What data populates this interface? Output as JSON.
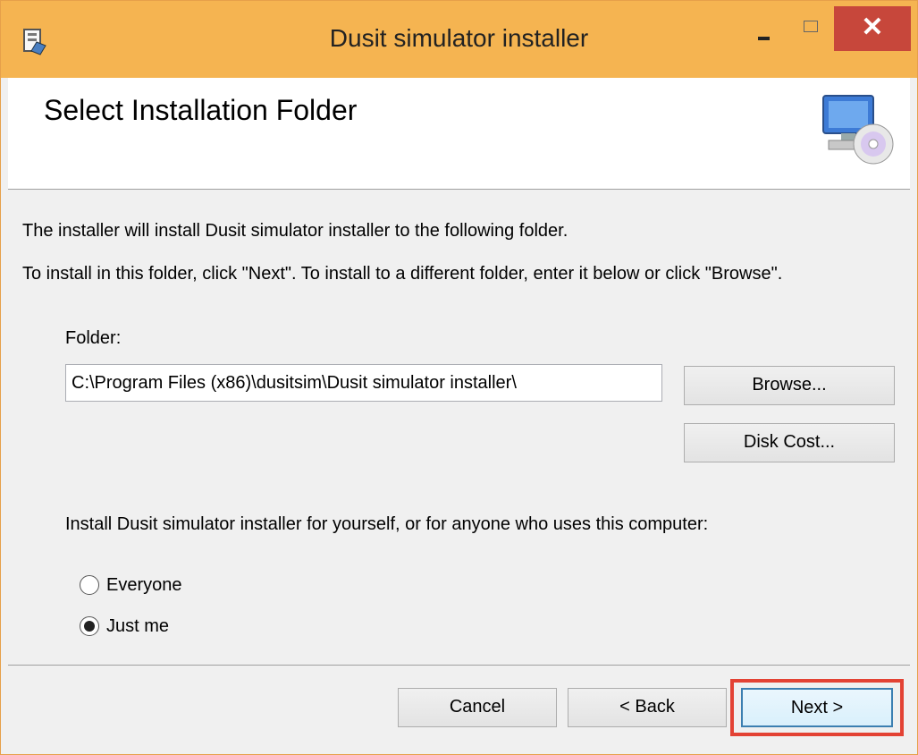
{
  "window": {
    "title": "Dusit simulator installer",
    "app_icon": "installer-icon",
    "controls": {
      "minimize_icon": "minimize-icon",
      "maximize_icon": "maximize-icon",
      "close_glyph": "✕"
    }
  },
  "header": {
    "title": "Select Installation Folder",
    "icon": "computer-disc-icon"
  },
  "body": {
    "intro_line1": "The installer will install Dusit simulator installer to the following folder.",
    "intro_line2": "To install in this folder, click \"Next\". To install to a different folder, enter it below or click \"Browse\".",
    "folder_label": "Folder:",
    "folder_value": "C:\\Program Files (x86)\\dusitsim\\Dusit simulator installer\\",
    "browse_label": "Browse...",
    "disk_cost_label": "Disk Cost...",
    "install_for_text": "Install Dusit simulator installer for yourself, or for anyone who uses this computer:",
    "options": [
      {
        "label": "Everyone",
        "selected": false
      },
      {
        "label": "Just me",
        "selected": true
      }
    ]
  },
  "footer": {
    "cancel_label": "Cancel",
    "back_label": "< Back",
    "next_label": "Next >"
  },
  "colors": {
    "titlebar": "#f5b451",
    "close_button": "#c7473b",
    "highlight": "#e34234"
  }
}
